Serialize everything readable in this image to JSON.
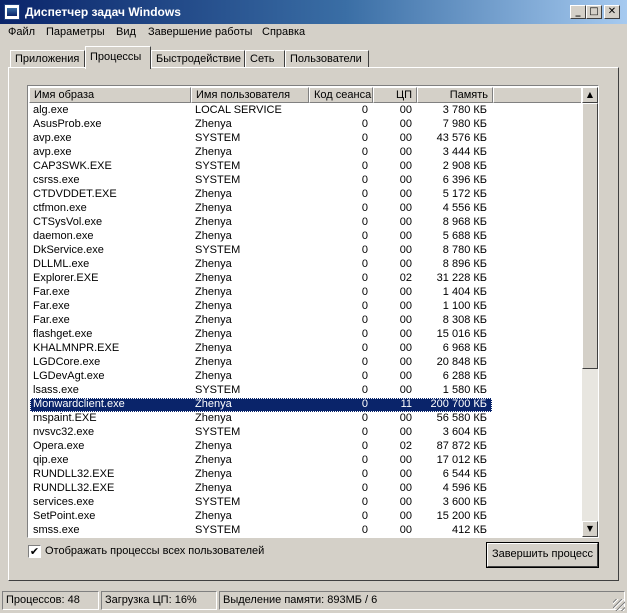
{
  "window": {
    "title": "Диспетчер задач Windows"
  },
  "titlebar_buttons": {
    "minimize": "_",
    "maximize": "□",
    "close": "✕"
  },
  "menu": [
    {
      "label": "Файл"
    },
    {
      "label": "Параметры"
    },
    {
      "label": "Вид"
    },
    {
      "label": "Завершение работы"
    },
    {
      "label": "Справка"
    }
  ],
  "tabs": [
    {
      "label": "Приложения"
    },
    {
      "label": "Процессы"
    },
    {
      "label": "Быстродействие"
    },
    {
      "label": "Сеть"
    },
    {
      "label": "Пользователи"
    }
  ],
  "active_tab": "Процессы",
  "table": {
    "columns": [
      "Имя образа",
      "Имя пользователя",
      "Код сеанса",
      "ЦП",
      "Память"
    ],
    "rows": [
      [
        "alg.exe",
        "LOCAL SERVICE",
        "0",
        "00",
        "3 780 КБ"
      ],
      [
        "AsusProb.exe",
        "Zhenya",
        "0",
        "00",
        "7 980 КБ"
      ],
      [
        "avp.exe",
        "SYSTEM",
        "0",
        "00",
        "43 576 КБ"
      ],
      [
        "avp.exe",
        "Zhenya",
        "0",
        "00",
        "3 444 КБ"
      ],
      [
        "CAP3SWK.EXE",
        "SYSTEM",
        "0",
        "00",
        "2 908 КБ"
      ],
      [
        "csrss.exe",
        "SYSTEM",
        "0",
        "00",
        "6 396 КБ"
      ],
      [
        "CTDVDDET.EXE",
        "Zhenya",
        "0",
        "00",
        "5 172 КБ"
      ],
      [
        "ctfmon.exe",
        "Zhenya",
        "0",
        "00",
        "4 556 КБ"
      ],
      [
        "CTSysVol.exe",
        "Zhenya",
        "0",
        "00",
        "8 968 КБ"
      ],
      [
        "daemon.exe",
        "Zhenya",
        "0",
        "00",
        "5 688 КБ"
      ],
      [
        "DkService.exe",
        "SYSTEM",
        "0",
        "00",
        "8 780 КБ"
      ],
      [
        "DLLML.exe",
        "Zhenya",
        "0",
        "00",
        "8 896 КБ"
      ],
      [
        "Explorer.EXE",
        "Zhenya",
        "0",
        "02",
        "31 228 КБ"
      ],
      [
        "Far.exe",
        "Zhenya",
        "0",
        "00",
        "1 404 КБ"
      ],
      [
        "Far.exe",
        "Zhenya",
        "0",
        "00",
        "1 100 КБ"
      ],
      [
        "Far.exe",
        "Zhenya",
        "0",
        "00",
        "8 308 КБ"
      ],
      [
        "flashget.exe",
        "Zhenya",
        "0",
        "00",
        "15 016 КБ"
      ],
      [
        "KHALMNPR.EXE",
        "Zhenya",
        "0",
        "00",
        "6 968 КБ"
      ],
      [
        "LGDCore.exe",
        "Zhenya",
        "0",
        "00",
        "20 848 КБ"
      ],
      [
        "LGDevAgt.exe",
        "Zhenya",
        "0",
        "00",
        "6 288 КБ"
      ],
      [
        "lsass.exe",
        "SYSTEM",
        "0",
        "00",
        "1 580 КБ"
      ],
      [
        "Monwardclient.exe",
        "Zhenya",
        "0",
        "11",
        "200 700 КБ"
      ],
      [
        "mspaint.EXE",
        "Zhenya",
        "0",
        "00",
        "56 580 КБ"
      ],
      [
        "nvsvc32.exe",
        "SYSTEM",
        "0",
        "00",
        "3 604 КБ"
      ],
      [
        "Opera.exe",
        "Zhenya",
        "0",
        "02",
        "87 872 КБ"
      ],
      [
        "qip.exe",
        "Zhenya",
        "0",
        "00",
        "17 012 КБ"
      ],
      [
        "RUNDLL32.EXE",
        "Zhenya",
        "0",
        "00",
        "6 544 КБ"
      ],
      [
        "RUNDLL32.EXE",
        "Zhenya",
        "0",
        "00",
        "4 596 КБ"
      ],
      [
        "services.exe",
        "SYSTEM",
        "0",
        "00",
        "3 600 КБ"
      ],
      [
        "SetPoint.exe",
        "Zhenya",
        "0",
        "00",
        "15 200 КБ"
      ],
      [
        "smss.exe",
        "SYSTEM",
        "0",
        "00",
        "412 КБ"
      ]
    ],
    "selected_row": 21
  },
  "scrollbar": {
    "up": "▲",
    "down": "▼"
  },
  "show_all_users": {
    "checked": "✔",
    "label": "Отображать процессы всех пользователей"
  },
  "end_process_button": "Завершить процесс",
  "status": {
    "processes": "Процессов: 48",
    "cpu": "Загрузка ЦП: 16%",
    "memory": "Выделение памяти: 893МБ / 6"
  }
}
